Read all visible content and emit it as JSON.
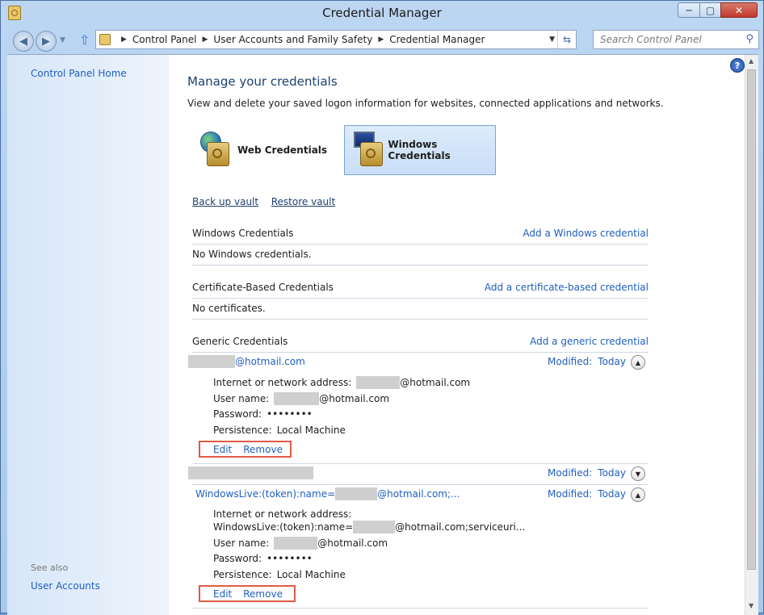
{
  "window": {
    "title": "Credential Manager",
    "minimize_glyph": "─",
    "maximize_glyph": "▢",
    "close_glyph": "✕"
  },
  "nav": {
    "back_icon": "back-arrow-icon",
    "forward_icon": "forward-arrow-icon",
    "up_icon": "up-arrow-icon",
    "breadcrumb": [
      "Control Panel",
      "User Accounts and Family Safety",
      "Credential Manager"
    ],
    "search_placeholder": "Search Control Panel"
  },
  "sidebar": {
    "home": "Control Panel Home",
    "see_also": "See also",
    "user_accounts": "User Accounts"
  },
  "help_glyph": "?",
  "main": {
    "title": "Manage your credentials",
    "description": "View and delete your saved logon information for websites, connected applications and networks.",
    "tiles": [
      {
        "label": "Web Credentials",
        "icon": "globe-vault-icon",
        "selected": false
      },
      {
        "label": "Windows Credentials",
        "icon": "monitor-vault-icon",
        "selected": true
      }
    ],
    "backup_vault": "Back up vault",
    "restore_vault": "Restore vault",
    "sections": {
      "windows": {
        "title": "Windows Credentials",
        "add": "Add a Windows credential",
        "empty": "No Windows credentials."
      },
      "certificate": {
        "title": "Certificate-Based Credentials",
        "add": "Add a certificate-based credential",
        "empty": "No certificates."
      },
      "generic": {
        "title": "Generic Credentials",
        "add": "Add a generic credential"
      }
    },
    "credentials": [
      {
        "name": "@hotmail.com",
        "modified_label": "Modified:",
        "modified_value": "Today",
        "expanded": true,
        "address_label": "Internet or network address:",
        "address_value": "@hotmail.com",
        "username_label": "User name:",
        "username_value": "@hotmail.com",
        "password_label": "Password:",
        "password_value": "••••••••",
        "persistence_label": "Persistence:",
        "persistence_value": "Local Machine",
        "edit": "Edit",
        "remove": "Remove"
      },
      {
        "name": "",
        "modified_label": "Modified:",
        "modified_value": "Today",
        "expanded": false
      },
      {
        "name_prefix": "WindowsLive:(token):name=",
        "name_suffix": "@hotmail.com;...",
        "modified_label": "Modified:",
        "modified_value": "Today",
        "expanded": true,
        "address_label": "Internet or network address:",
        "address_prefix": "WindowsLive:(token):name=",
        "address_suffix": "@hotmail.com;serviceuri...",
        "username_label": "User name:",
        "username_value": "@hotmail.com",
        "password_label": "Password:",
        "password_value": "••••••••",
        "persistence_label": "Persistence:",
        "persistence_value": "Local Machine",
        "edit": "Edit",
        "remove": "Remove"
      }
    ]
  }
}
